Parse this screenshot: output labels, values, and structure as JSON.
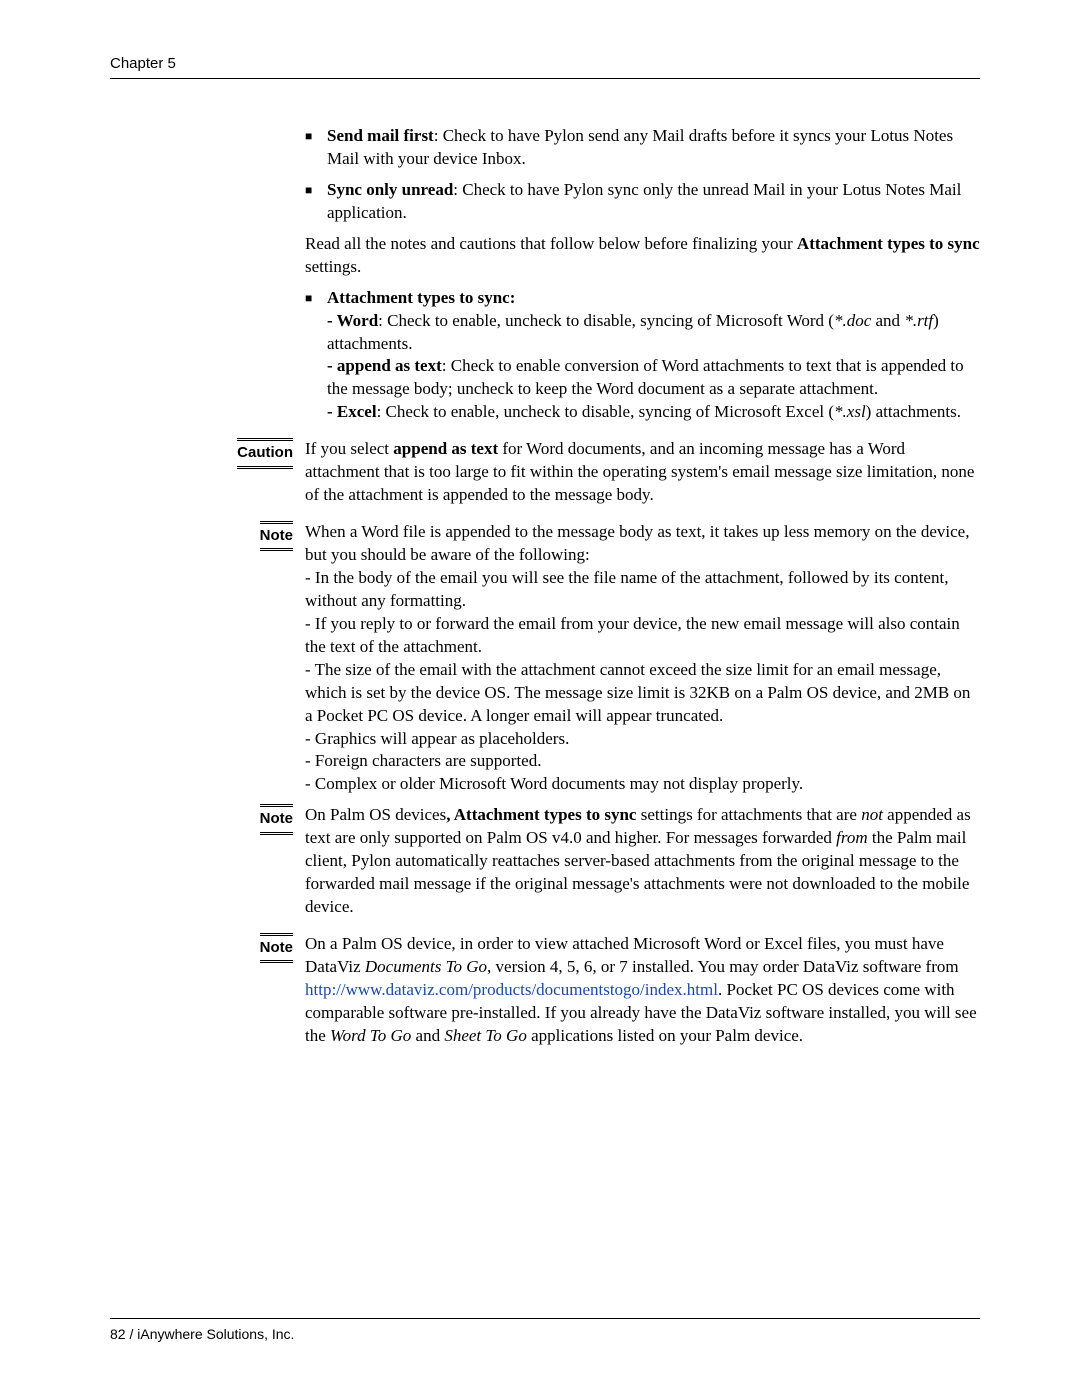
{
  "header": {
    "chapter": "Chapter 5"
  },
  "bullets_top": [
    {
      "lead": "Send mail first",
      "text": ": Check to have Pylon send any Mail drafts before it syncs your Lotus Notes Mail with your device Inbox."
    },
    {
      "lead": "Sync only unread",
      "text": ": Check to have Pylon sync only the unread Mail in your Lotus Notes Mail application."
    }
  ],
  "intro": {
    "pre": "Read all the notes and cautions that follow below before finalizing your ",
    "bold": "Attachment types to sync",
    "post": " settings."
  },
  "attach": {
    "title": "Attachment types to sync:",
    "word": {
      "lead": "- Word",
      "text1": ": Check to enable, uncheck to disable, syncing of Microsoft Word (",
      "ital1": "*.doc",
      "joiner": " and ",
      "ital2": "*.rtf",
      "text2": ") attachments."
    },
    "append": {
      "lead": "- append as text",
      "text": ": Check to enable conversion of Word attachments to text that is appended to the message body; uncheck to keep the Word document as a separate attachment."
    },
    "excel": {
      "lead": "- Excel",
      "text1": ": Check to enable, uncheck to disable, syncing of Microsoft Excel (",
      "ital": "*.xsl",
      "text2": ") attachments."
    }
  },
  "caution": {
    "label": "Caution",
    "pre": "If you select ",
    "bold": "append as text",
    "post": " for Word documents, and an incoming message has a Word attachment that is too large to fit within the operating system's email message size limitation, none of the attachment is appended to the message body."
  },
  "note1": {
    "label": "Note",
    "p1": "When a Word file is appended to the message body as text, it takes up less memory on the device, but you should be aware of the following:",
    "l1": "- In the body of the email you will see the file name of the attachment, followed by its content, without any formatting.",
    "l2": "- If you reply to or forward the email from your device, the new email message will also contain the text of the attachment.",
    "l3": "- The size of the email with the attachment cannot exceed the size limit for an email message, which is set by the device OS. The message size limit is 32KB on a Palm OS device, and 2MB on a Pocket PC OS device. A longer email will appear truncated.",
    "l4": "- Graphics will appear as placeholders.",
    "l5": "- Foreign characters are supported.",
    "l6": "- Complex or older Microsoft Word documents may not display properly."
  },
  "note2": {
    "label": "Note",
    "pre": "On Palm OS devices",
    "bold": ", Attachment types to sync",
    "mid1": " settings for attachments that are ",
    "ital1": "not",
    "mid2": " appended as text are only supported on Palm OS v4.0 and higher. For messages forwarded ",
    "ital2": "from",
    "post": " the Palm mail client, Pylon automatically reattaches server-based attachments from the original message to the forwarded mail message if the original message's attachments were not downloaded to the mobile device."
  },
  "note3": {
    "label": "Note",
    "pre": "On a Palm OS device, in order to view attached Microsoft Word or Excel files, you must have DataViz ",
    "ital1": "Documents To Go",
    "mid1": ", version 4, 5, 6, or 7 installed. You may order DataViz software from ",
    "link": "http://www.dataviz.com/products/documentstogo/index.html",
    "mid2": ". Pocket PC OS devices come with comparable software pre-installed. If you already have the DataViz software installed, you will see the ",
    "ital2": "Word To Go",
    "mid3": " and ",
    "ital3": "Sheet To Go",
    "post": " applications listed on your Palm device."
  },
  "footer": {
    "page": "82",
    "sep": "  /  ",
    "company": "iAnywhere Solutions, Inc."
  }
}
